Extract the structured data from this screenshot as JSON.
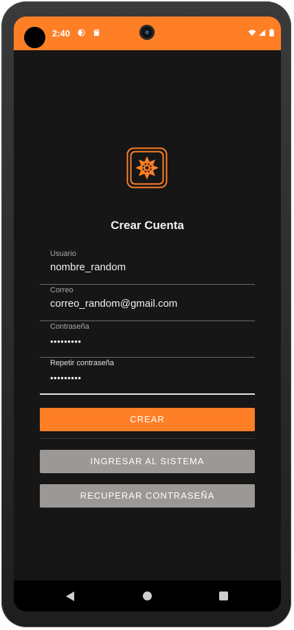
{
  "status_bar": {
    "time": "2:40",
    "icons": [
      "assistant-icon",
      "sd-card-icon",
      "wifi-icon",
      "cell-signal-icon",
      "battery-icon"
    ]
  },
  "colors": {
    "accent": "#ff7f27",
    "background": "#161616",
    "secondary_button": "#9b9895"
  },
  "screen": {
    "logo_icon": "app-logo-icon",
    "title": "Crear Cuenta"
  },
  "form": {
    "username": {
      "label": "Usuario",
      "value": "nombre_random"
    },
    "email": {
      "label": "Correo",
      "value": "correo_random@gmail.com"
    },
    "password": {
      "label": "Contraseña",
      "value": "•••••••••"
    },
    "repeat_password": {
      "label": "Repetir contraseña",
      "value": "•••••••••"
    }
  },
  "buttons": {
    "create": "CREAR",
    "login": "INGRESAR AL SISTEMA",
    "recover": "RECUPERAR CONTRASEÑA"
  },
  "nav_bar": {
    "icons": [
      "back-icon",
      "home-icon",
      "recents-icon"
    ]
  }
}
